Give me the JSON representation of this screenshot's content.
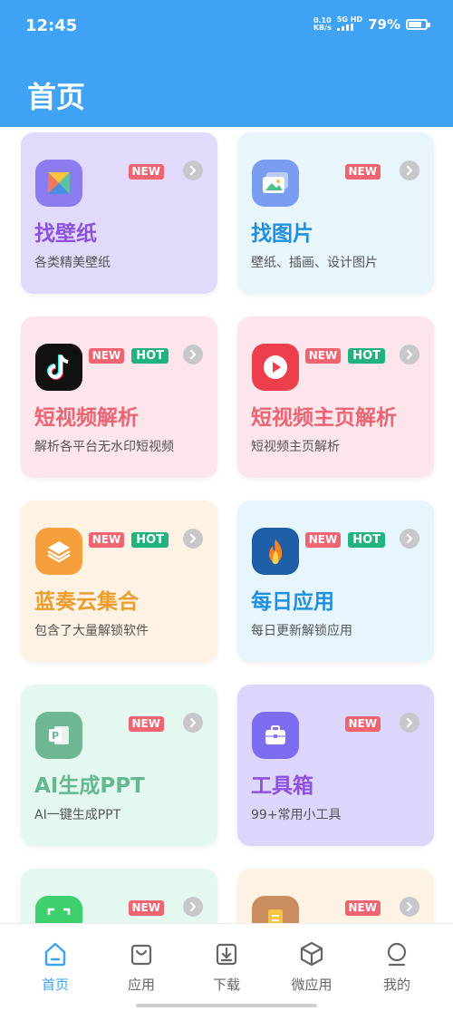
{
  "status": {
    "time": "12:45",
    "net_speed_value": "0.10",
    "net_speed_unit": "KB/s",
    "signal": "5G HD",
    "battery_pct": "79%",
    "battery_level": 0.79
  },
  "header": {
    "title": "首页"
  },
  "cards": [
    {
      "title": "找壁纸",
      "desc": "各类精美壁纸",
      "badges": [
        "NEW"
      ],
      "bg": "#e1dafb",
      "title_color": "#8e50dd",
      "icon": "tangram-icon"
    },
    {
      "title": "找图片",
      "desc": "壁纸、插画、设计图片",
      "badges": [
        "NEW"
      ],
      "bg": "#e8f6fc",
      "title_color": "#1f8fe0",
      "icon": "gallery-icon"
    },
    {
      "title": "短视频解析",
      "desc": "解析各平台无水印短视频",
      "badges": [
        "NEW",
        "HOT"
      ],
      "bg": "#fce6ec",
      "title_color": "#ea6473",
      "icon": "tiktok-icon"
    },
    {
      "title": "短视频主页解析",
      "desc": "短视频主页解析",
      "badges": [
        "NEW",
        "HOT"
      ],
      "bg": "#fce6ec",
      "title_color": "#ea6473",
      "icon": "play-icon"
    },
    {
      "title": "蓝奏云集合",
      "desc": "包含了大量解锁软件",
      "badges": [
        "NEW",
        "HOT"
      ],
      "bg": "#fef2e4",
      "title_color": "#eb9d2f",
      "icon": "layers-icon"
    },
    {
      "title": "每日应用",
      "desc": "每日更新解锁应用",
      "badges": [
        "NEW",
        "HOT"
      ],
      "bg": "#e6f6fc",
      "title_color": "#1f8fe0",
      "icon": "flame-icon"
    },
    {
      "title": "AI生成PPT",
      "desc": "AI一键生成PPT",
      "badges": [
        "NEW"
      ],
      "bg": "#e5f8f0",
      "title_color": "#63b88f",
      "icon": "ppt-icon"
    },
    {
      "title": "工具箱",
      "desc": "99+常用小工具",
      "badges": [
        "NEW"
      ],
      "bg": "#dcd6fb",
      "title_color": "#8e50dd",
      "icon": "toolbox-icon"
    },
    {
      "title": "",
      "desc": "",
      "badges": [
        "NEW"
      ],
      "bg": "#e5f8f0",
      "title_color": "#63b88f",
      "icon": "scan-icon"
    },
    {
      "title": "",
      "desc": "",
      "badges": [
        "NEW"
      ],
      "bg": "#fef2e4",
      "title_color": "#eb9d2f",
      "icon": "document-icon"
    }
  ],
  "tabbar": {
    "items": [
      {
        "label": "首页",
        "icon": "home-icon",
        "active": true
      },
      {
        "label": "应用",
        "icon": "shopping-bag-icon",
        "active": false
      },
      {
        "label": "下载",
        "icon": "download-icon",
        "active": false
      },
      {
        "label": "微应用",
        "icon": "cube-icon",
        "active": false
      },
      {
        "label": "我的",
        "icon": "user-icon",
        "active": false
      }
    ]
  },
  "colors": {
    "primary": "#3fa2f5",
    "badge_new": "#ef6470",
    "badge_hot": "#22b27d"
  }
}
